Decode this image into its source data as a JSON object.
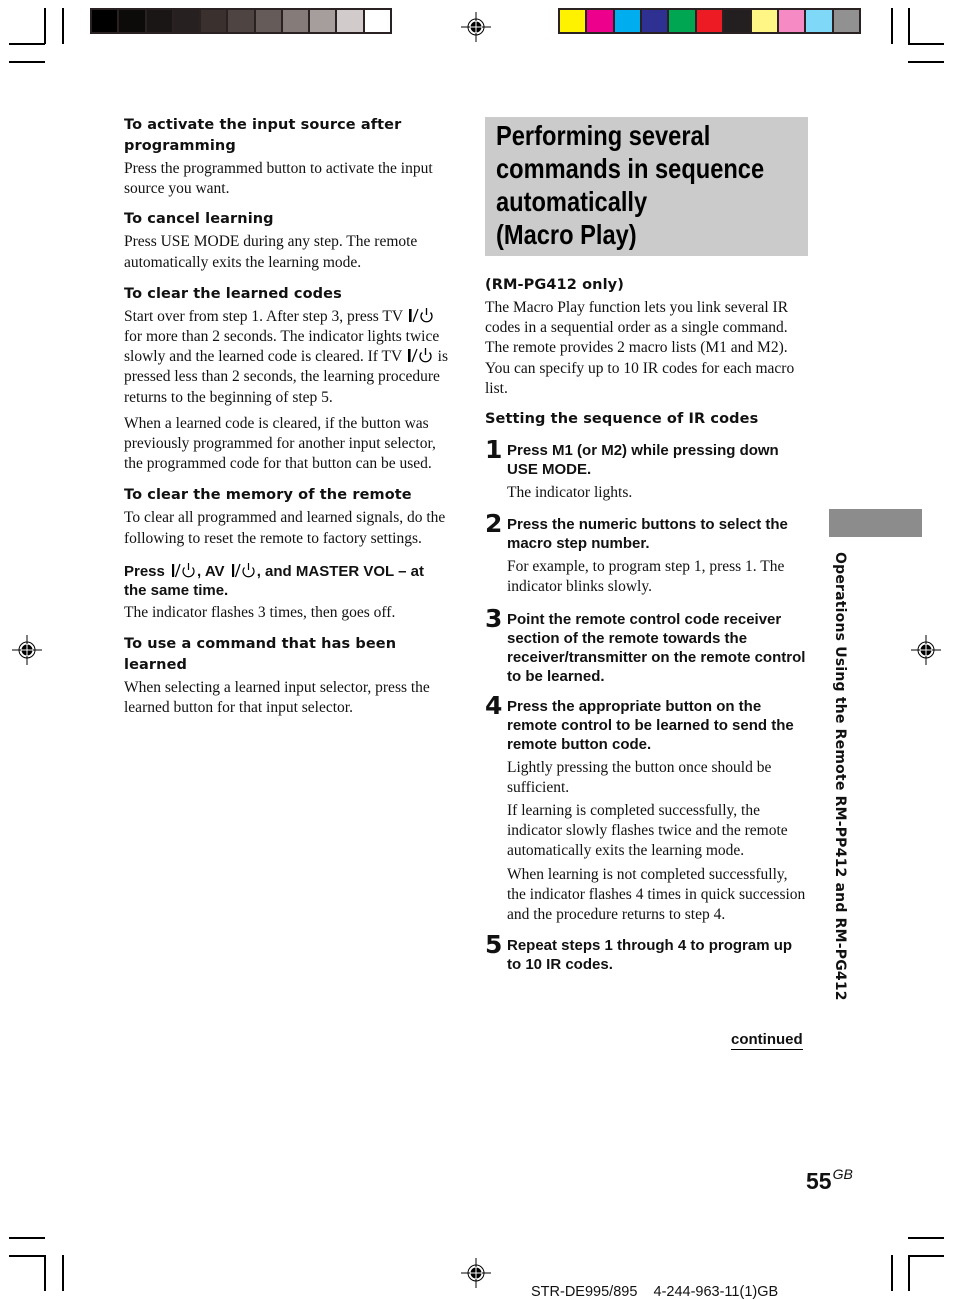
{
  "print_marks": {
    "grayscale_swatches": [
      "#000000",
      "#0d0b0a",
      "#1a1615",
      "#262120",
      "#3a302e",
      "#4e4442",
      "#655b59",
      "#857b79",
      "#a59e9c",
      "#d2cbcb",
      "#ffffff"
    ],
    "color_swatches": [
      "#fff200",
      "#ec008c",
      "#00aeef",
      "#2e3192",
      "#00a651",
      "#ed1c24",
      "#231f20",
      "#fff685",
      "#f58ac4",
      "#7fd8f7",
      "#919191"
    ]
  },
  "left_column": {
    "sections": [
      {
        "heading": "To activate the input source after programming",
        "paragraphs": [
          "Press the programmed button to activate the input source you want."
        ]
      },
      {
        "heading": "To cancel learning",
        "paragraphs": [
          "Press USE MODE during any step. The remote automatically exits the learning mode."
        ]
      },
      {
        "heading": "To clear the learned codes",
        "p1_a": "Start over from step 1. After step 3, press TV ",
        "p1_b": " for more than 2 seconds. The indicator lights twice slowly and the learned code is cleared. If TV ",
        "p1_c": " is pressed less than 2 seconds, the learning procedure returns to the beginning of step 5.",
        "p2": "When a learned code is cleared, if the button was previously programmed for another input selector, the programmed code for that button can be used."
      },
      {
        "heading": "To clear the memory of the remote",
        "p1": "To clear all programmed and learned signals, do the following to reset the remote to factory settings.",
        "inst_a": "Press ",
        "inst_b": ", AV ",
        "inst_c": ", and MASTER VOL – at the same time.",
        "p2": "The indicator flashes 3 times, then goes off."
      },
      {
        "heading": "To use a command that has been learned",
        "paragraphs": [
          "When selecting a learned input selector, press the learned button for that input selector."
        ]
      }
    ]
  },
  "right_column": {
    "title": [
      "Performing several",
      "commands in sequence",
      "automatically",
      "(Macro Play)"
    ],
    "model_note": "(RM-PG412 only)",
    "intro": "The Macro Play function lets you link several IR codes in a sequential order as a single command. The remote provides 2 macro lists (M1 and M2). You can specify up to 10 IR codes for each macro list.",
    "subheading": "Setting the sequence of IR codes",
    "steps": [
      {
        "num": "1",
        "instruction": "Press M1 (or M2) while pressing down USE MODE.",
        "notes": [
          "The indicator lights."
        ]
      },
      {
        "num": "2",
        "instruction": "Press the numeric buttons to select the macro step number.",
        "notes": [
          "For example, to program step 1, press 1. The indicator blinks slowly."
        ]
      },
      {
        "num": "3",
        "instruction": "Point the remote control code receiver section of the remote towards the receiver/transmitter on the remote control to be learned.",
        "notes": []
      },
      {
        "num": "4",
        "instruction": "Press the appropriate button on the remote control to be learned to send the remote button code.",
        "notes": [
          "Lightly pressing the button once should be sufficient.",
          "If learning is completed successfully, the indicator slowly flashes twice and the remote automatically exits the learning mode.",
          "When learning is not completed successfully, the indicator flashes 4 times in quick succession and the procedure returns to step 4."
        ]
      },
      {
        "num": "5",
        "instruction": "Repeat steps 1 through 4 to program up to 10 IR codes.",
        "notes": []
      }
    ],
    "continued": "continued"
  },
  "side_tab": {
    "label": "Operations Using the Remote RM-PP412 and RM-PG412",
    "color": "#8c8c8c"
  },
  "page": {
    "number": "55",
    "suffix": "GB",
    "footer": "STR-DE995/895    4-244-963-11(1)GB"
  },
  "icons": {
    "power": "power-standby-icon"
  }
}
